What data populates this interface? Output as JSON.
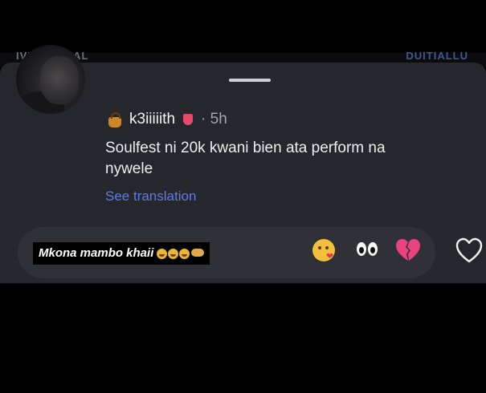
{
  "background_top_text": {
    "left": "IVIALLESIAL",
    "right": "DUITIALLU"
  },
  "comment": {
    "username": "k3iiiiith",
    "username_badge_icon": "money-bag-icon",
    "username_suffix_icon": "tongue-emoji-icon",
    "time": "· 5h",
    "text": "Soulfest ni 20k kwani bien ata perform na nywele",
    "see_translation": "See translation"
  },
  "reply_bar": {
    "text": "Mkona mambo khaii",
    "quick_reactions": [
      "kissing-heart-emoji",
      "eyes-emoji",
      "broken-heart-emoji"
    ]
  },
  "like_icon": "heart-outline-icon",
  "colors": {
    "sheet": "#25272c",
    "accent_link": "#5b7cf0",
    "broken_heart": "#e8437e"
  }
}
